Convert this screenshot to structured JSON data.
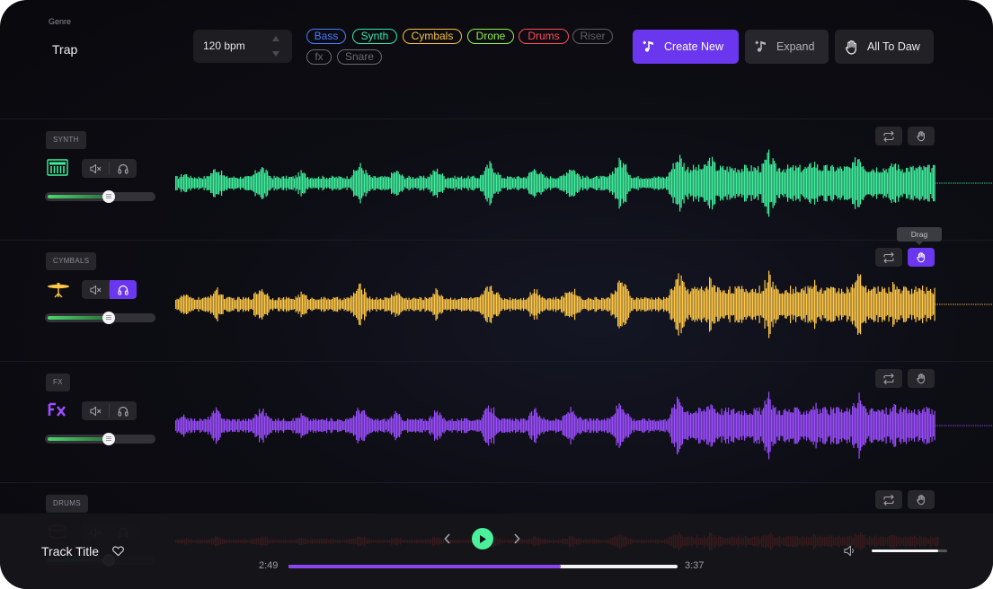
{
  "colors": {
    "accent": "#6a37ee",
    "synth": "#3ff09d",
    "cymbals": "#ffc848",
    "fx": "#9b4dff",
    "drums": "#ff3c3c",
    "play": "#4cf09b",
    "progress": "#8a44f2"
  },
  "header": {
    "genre_label": "Genre",
    "genre_value": "Trap",
    "bpm": "120 bpm",
    "tags": [
      {
        "label": "Bass",
        "color": "#4a7dff"
      },
      {
        "label": "Synth",
        "color": "#39e6a4"
      },
      {
        "label": "Cymbals",
        "color": "#f6c046"
      },
      {
        "label": "Drone",
        "color": "#8ef14a"
      },
      {
        "label": "Drums",
        "color": "#ff4d5a"
      },
      {
        "label": "Riser",
        "color": "#5f5f66"
      },
      {
        "label": "fx",
        "color": "#6a6a72"
      },
      {
        "label": "Snare",
        "color": "#6a6a72"
      }
    ],
    "create_new": "Create New",
    "expand": "Expand",
    "all_to_daw": "All To Daw"
  },
  "tracks": [
    {
      "label": "SYNTH",
      "icon": "keyboard-icon",
      "color": "#3ff09d",
      "solo_active": false,
      "volume": 0.58,
      "drag_active": false
    },
    {
      "label": "CYMBALS",
      "icon": "cymbal-icon",
      "color": "#ffc848",
      "solo_active": true,
      "volume": 0.58,
      "drag_active": true
    },
    {
      "label": "FX",
      "icon": "fx-icon",
      "color": "#9b4dff",
      "solo_active": false,
      "volume": 0.58,
      "drag_active": false
    },
    {
      "label": "DRUMS",
      "icon": "drum-icon",
      "color": "#ff3c3c",
      "solo_active": false,
      "volume": 0.58,
      "drag_active": false
    }
  ],
  "tooltip": {
    "drag": "Drag"
  },
  "player": {
    "track_title": "Track Title",
    "time_current": "2:49",
    "time_total": "3:37",
    "progress": 0.7,
    "volume": 0.88
  }
}
